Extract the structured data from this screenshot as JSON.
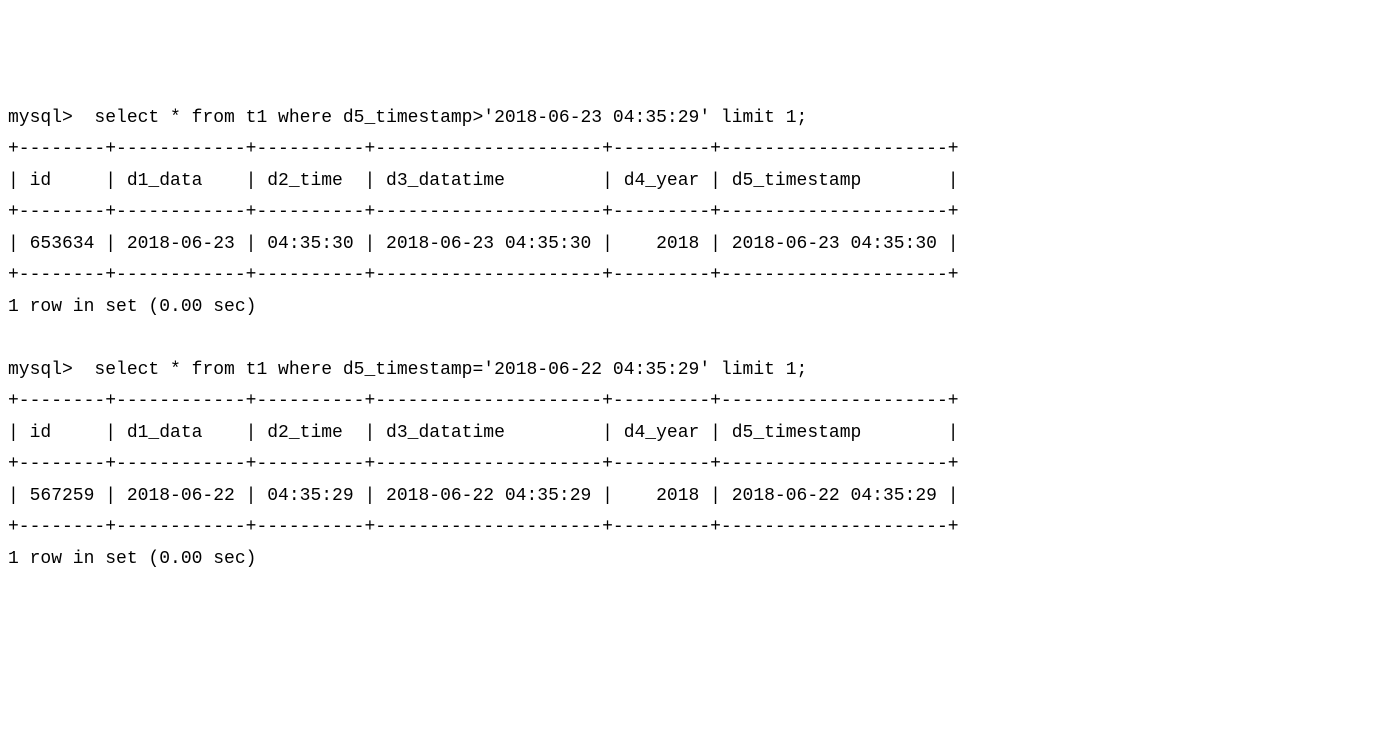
{
  "queries": [
    {
      "prompt": "mysql> ",
      "command": " select * from t1 where d5_timestamp>'2018-06-23 04:35:29' limit 1;",
      "separator": "+--------+------------+----------+---------------------+---------+---------------------+",
      "header": "| id     | d1_data    | d2_time  | d3_datatime         | d4_year | d5_timestamp        |",
      "row": "| 653634 | 2018-06-23 | 04:35:30 | 2018-06-23 04:35:30 |    2018 | 2018-06-23 04:35:30 |",
      "footer": "1 row in set (0.00 sec)",
      "columns": [
        "id",
        "d1_data",
        "d2_time",
        "d3_datatime",
        "d4_year",
        "d5_timestamp"
      ],
      "data": {
        "id": "653634",
        "d1_data": "2018-06-23",
        "d2_time": "04:35:30",
        "d3_datatime": "2018-06-23 04:35:30",
        "d4_year": "2018",
        "d5_timestamp": "2018-06-23 04:35:30"
      }
    },
    {
      "prompt": "mysql> ",
      "command": " select * from t1 where d5_timestamp='2018-06-22 04:35:29' limit 1;",
      "separator": "+--------+------------+----------+---------------------+---------+---------------------+",
      "header": "| id     | d1_data    | d2_time  | d3_datatime         | d4_year | d5_timestamp        |",
      "row": "| 567259 | 2018-06-22 | 04:35:29 | 2018-06-22 04:35:29 |    2018 | 2018-06-22 04:35:29 |",
      "footer": "1 row in set (0.00 sec)",
      "columns": [
        "id",
        "d1_data",
        "d2_time",
        "d3_datatime",
        "d4_year",
        "d5_timestamp"
      ],
      "data": {
        "id": "567259",
        "d1_data": "2018-06-22",
        "d2_time": "04:35:29",
        "d3_datatime": "2018-06-22 04:35:29",
        "d4_year": "2018",
        "d5_timestamp": "2018-06-22 04:35:29"
      }
    }
  ]
}
